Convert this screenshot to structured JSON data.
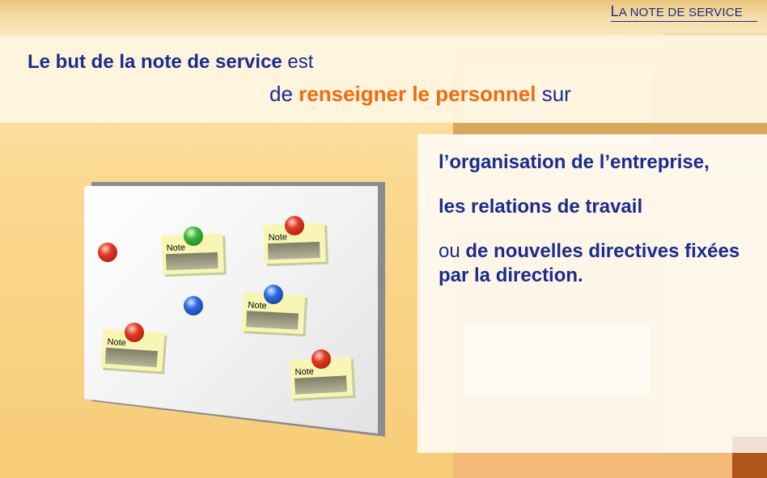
{
  "header": {
    "section_title_first": "L",
    "section_title_rest": "A NOTE DE SERVICE"
  },
  "intro": {
    "part1_bold": "Le but de la note de service",
    "part1_rest": " est",
    "part2_start": "de ",
    "part2_highlight": "renseigner le personnel",
    "part2_end": " sur"
  },
  "list": {
    "item1": "l’organisation de l’entreprise,",
    "item2": "les relations de travail",
    "item3_prefix": "ou ",
    "item3_bold": "de nouvelles directives fixées par la direction."
  },
  "board": {
    "note_label": "Note"
  },
  "colors": {
    "text_blue": "#1b2c8f",
    "accent_orange": "#ef6c10",
    "pin_red": "#e03a24",
    "pin_green": "#3fb83a",
    "pin_blue": "#2d6de0"
  }
}
